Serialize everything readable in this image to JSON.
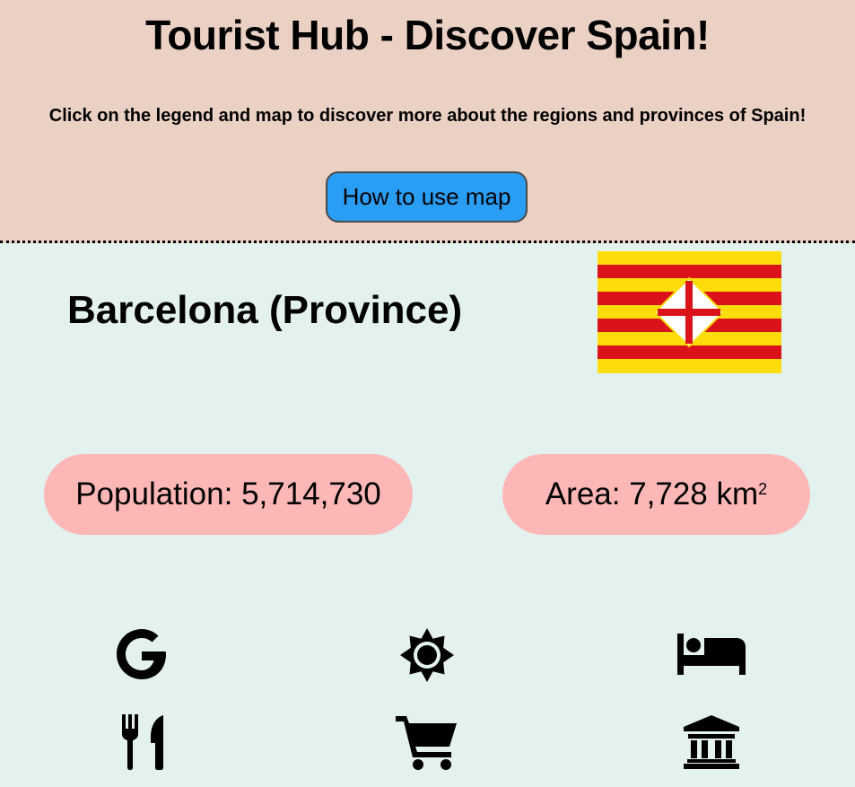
{
  "header": {
    "title": "Tourist Hub - Discover Spain!",
    "subtitle": "Click on the legend and map to discover more about the regions and provinces of Spain!",
    "how_to_button": "How to use map"
  },
  "province": {
    "name": "Barcelona (Province)",
    "population_label": "Population: 5,714,730",
    "area_label": "Area: 7,728 km",
    "area_superscript": "2",
    "flag_colors": {
      "yellow": "#fcdd09",
      "red": "#da121a",
      "white": "#ffffff"
    }
  },
  "icons": [
    {
      "name": "google-icon"
    },
    {
      "name": "weather-sun-icon"
    },
    {
      "name": "bed-hotel-icon"
    },
    {
      "name": "restaurant-utensils-icon"
    },
    {
      "name": "shopping-cart-icon"
    },
    {
      "name": "museum-landmark-icon"
    }
  ],
  "colors": {
    "header_bg": "#ebd1c4",
    "main_bg": "#e3f2ef",
    "button_bg": "#2a9df4",
    "pill_bg": "#fdb7b6"
  }
}
